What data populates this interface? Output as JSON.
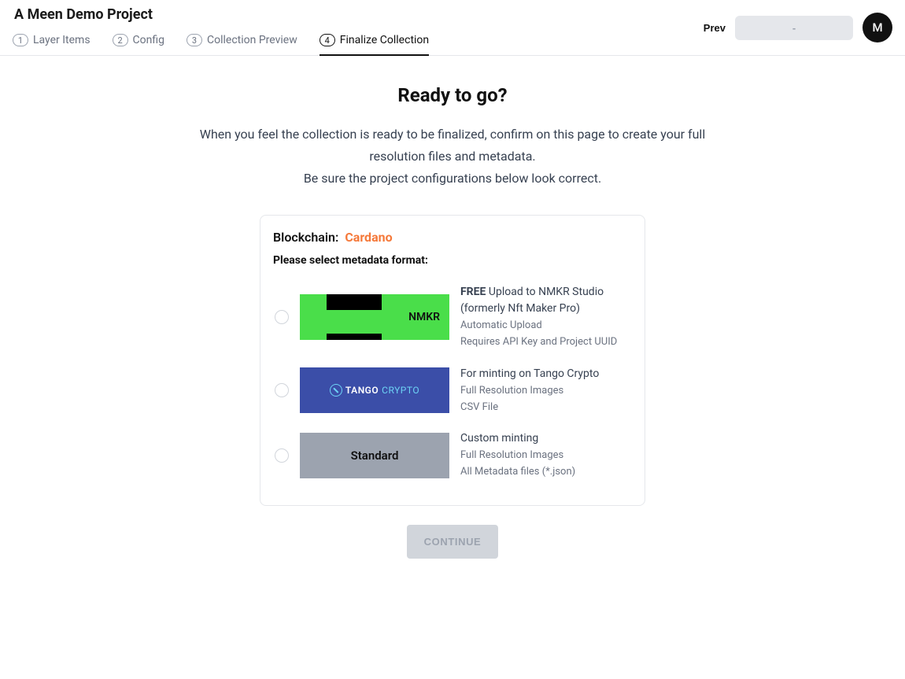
{
  "header": {
    "project_title": "A Meen Demo Project",
    "tabs": [
      {
        "num": "1",
        "label": "Layer Items"
      },
      {
        "num": "2",
        "label": "Config"
      },
      {
        "num": "3",
        "label": "Collection Preview"
      },
      {
        "num": "4",
        "label": "Finalize Collection"
      }
    ],
    "active_tab_index": 3,
    "prev_label": "Prev",
    "next_label": "-",
    "avatar_initial": "M"
  },
  "main": {
    "title": "Ready to go?",
    "desc_line1": "When you feel the collection is ready to be finalized, confirm on this page to create your full resolution files and metadata.",
    "desc_line2": "Be sure the project configurations below look correct."
  },
  "card": {
    "blockchain_label": "Blockchain:",
    "blockchain_value": "Cardano",
    "format_label": "Please select metadata format:",
    "options": [
      {
        "id": "nmkr",
        "logo_text": "NMKR",
        "title_prefix_bold": "FREE",
        "title_rest": " Upload to NMKR Studio (formerly Nft Maker Pro)",
        "sub1": "Automatic Upload",
        "sub2": "Requires API Key and Project UUID"
      },
      {
        "id": "tango",
        "logo_text_a": "TANGO",
        "logo_text_b": "CRYPTO",
        "title": "For minting on Tango Crypto",
        "sub1": "Full Resolution Images",
        "sub2": "CSV File"
      },
      {
        "id": "standard",
        "logo_text": "Standard",
        "title": "Custom minting",
        "sub1": "Full Resolution Images",
        "sub2": "All Metadata files (*.json)"
      }
    ]
  },
  "continue_label": "CONTINUE"
}
